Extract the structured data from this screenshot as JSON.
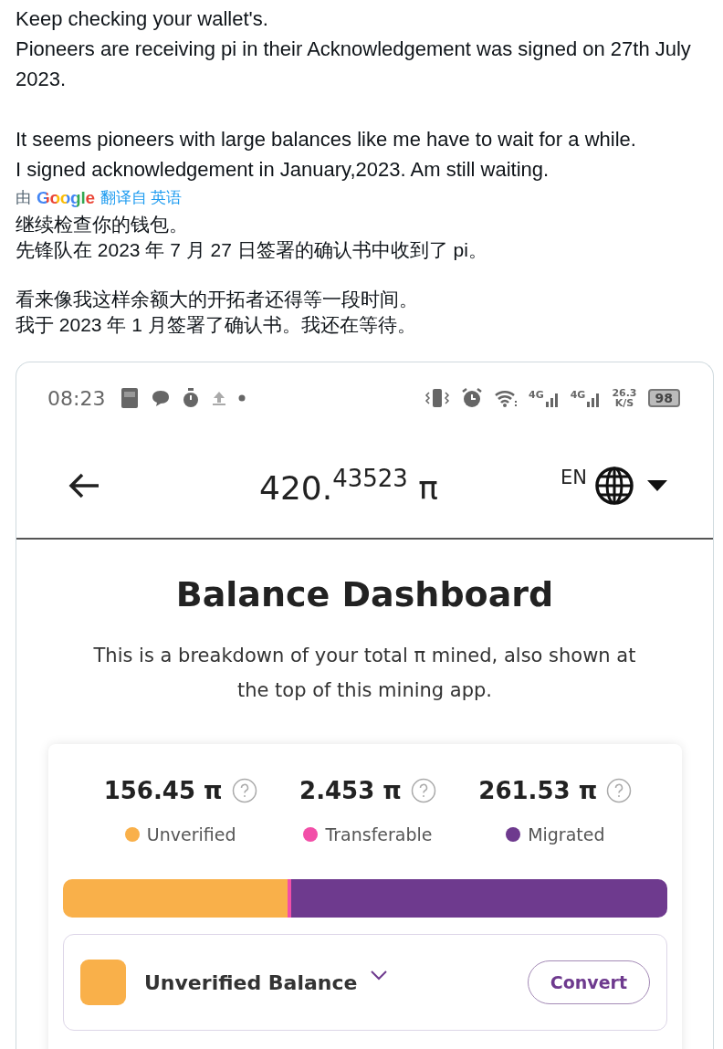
{
  "tweet": {
    "paragraphs": [
      [
        "Keep checking your wallet's.",
        "Pioneers are receiving pi in their Acknowledgement was signed on 27th July 2023."
      ],
      [
        "It seems pioneers with large balances like me have to wait for a while.",
        "I signed acknowledgement in January,2023. Am still waiting."
      ]
    ],
    "translation_note": {
      "prefix": "由",
      "logo": "Google",
      "link": "翻译自 英语"
    },
    "translated_paragraphs": [
      [
        "继续检查你的钱包。",
        "先锋队在 2023 年 7 月 27 日签署的确认书中收到了 pi。"
      ],
      [
        "看来像我这样余额大的开拓者还得等一段时间。",
        "我于 2023 年 1 月签署了确认书。我还在等待。"
      ]
    ]
  },
  "phone": {
    "status_bar": {
      "time": "08:23",
      "network_1": "4G",
      "network_2": "4G",
      "speed": "26.3",
      "speed_unit": "K/S",
      "battery": "98"
    },
    "header": {
      "balance": "420.$^{43523}$ π",
      "language": "EN"
    },
    "title": "Balance Dashboard",
    "description": "This is a breakdown of your total π mined, also shown at the top of this mining app.",
    "balances": [
      {
        "amount": "156.45 π",
        "label": "Unverified",
        "color": "#f9b04a"
      },
      {
        "amount": "2.453 π",
        "label": "Transferable",
        "color": "#f24fa8"
      },
      {
        "amount": "261.53 π",
        "label": "Migrated",
        "color": "#6e3a8e"
      }
    ],
    "balance_row": {
      "label": "Unverified Balance",
      "color": "#f9b04a",
      "button": "Convert"
    }
  }
}
